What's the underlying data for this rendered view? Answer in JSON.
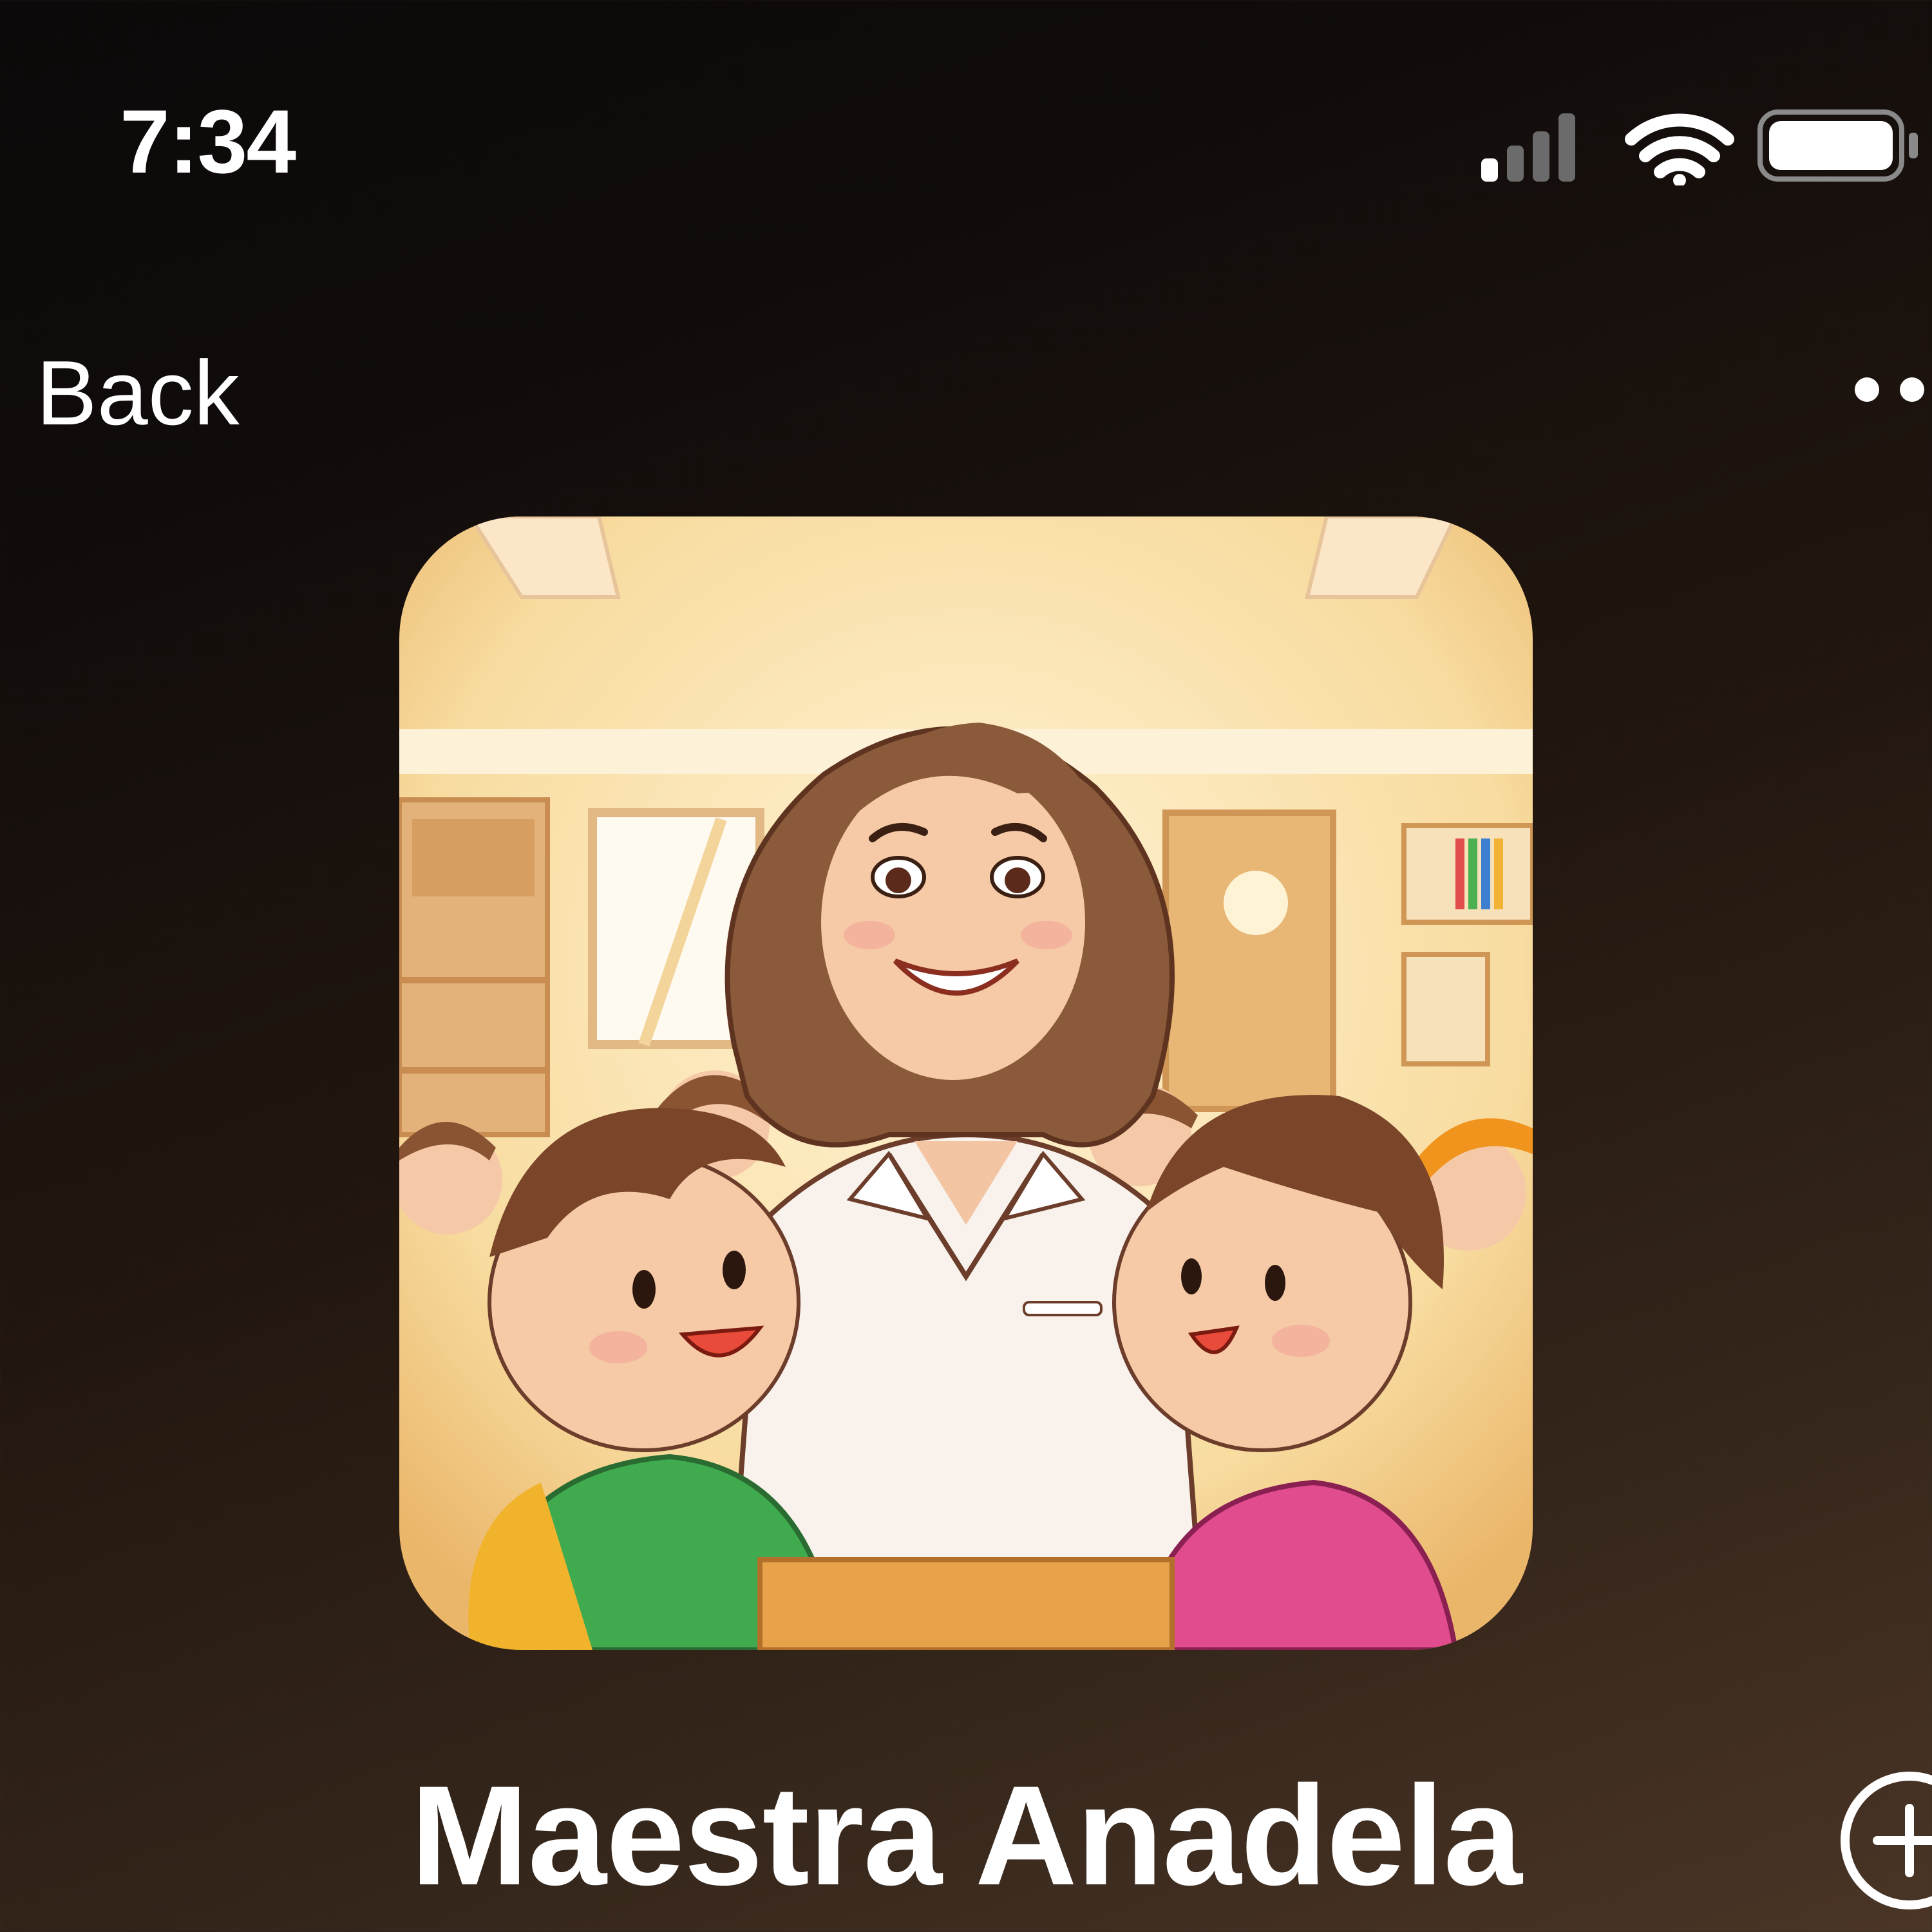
{
  "status_bar": {
    "time": "7:34",
    "icons": [
      "cellular-signal-icon",
      "wifi-icon",
      "battery-icon"
    ]
  },
  "nav": {
    "back_label": "Back",
    "more_icon": "more-options-icon"
  },
  "artwork": {
    "description_icon": "teacher-classroom-artwork"
  },
  "title": "Maestra Anadela",
  "actions": {
    "add_icon": "add-circle-icon"
  },
  "colors": {
    "text": "#ffffff",
    "background_top": "#0b0909",
    "background_bottom": "#4a3526"
  }
}
